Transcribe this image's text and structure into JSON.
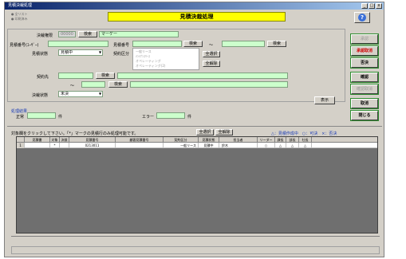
{
  "window": {
    "title": "見積決裁処理",
    "title_buttons": [
      "_",
      "□",
      "x"
    ]
  },
  "header": {
    "radios": [
      "全リスト",
      "印刷済み"
    ],
    "panel_title": "見積決裁処理",
    "help_glyph": "?"
  },
  "form": {
    "decision_authority_label": "決裁権限",
    "decision_authority_value": "00000",
    "decision_authority_button": "検索",
    "decision_authority_name": "マーケー",
    "customer_code_label": "見積番号(ﾕｰｻﾞｰ)",
    "estimate_no_label": "見積番号",
    "estimate_search_button": "検索",
    "range_sep": "～",
    "estimate_search_button2": "検索",
    "estimate_status_label": "見積状態",
    "estimate_status_value": "見積中",
    "contract_type_label": "契約区分",
    "contract_types": [
      "一般リース",
      "ﾒﾝﾃﾅﾝｽﾘｰｽ",
      "オペレーティング",
      "オペレーティング(2)"
    ],
    "select_all_button": "全選択",
    "clear_all_button": "全解除",
    "contractor_label": "契約先",
    "contractor_button": "検索",
    "contractor_range_sep": "～",
    "contractor_button2": "検索",
    "decider_label": "決裁状態",
    "decider_value": "未決",
    "display_button": "表示"
  },
  "counts": {
    "section_label": "処理結果",
    "ok_label": "正常",
    "ok_unit": "件",
    "error_label": "エラー",
    "error_unit": "件"
  },
  "side_buttons": [
    {
      "label": "承認",
      "style": "dis"
    },
    {
      "label": "承認取消",
      "style": "red"
    },
    {
      "label": "否決",
      "style": "normal"
    },
    {
      "label": "確認",
      "style": "normal"
    },
    {
      "label": "確認取消",
      "style": "dis"
    },
    {
      "label": "取消",
      "style": "normal"
    },
    {
      "label": "閉じる",
      "style": "normal"
    }
  ],
  "list_info": {
    "hint": "対象欄をクリックして下さい。「*」マークの見積行のみ処理可能です。",
    "select_all_button": "全選択",
    "clear_all_button": "全解除",
    "legend": "△：見積作成中　○：可決　×：否決"
  },
  "grid": {
    "columns": [
      "",
      "見積書",
      "対象",
      "決裁",
      "見積番号",
      "顧客見積番号",
      "契約区分",
      "見積状態",
      "担当者",
      "リーダー",
      "課長",
      "部長",
      "社長"
    ],
    "rows": [
      [
        "1",
        "",
        "*",
        "",
        "0213011",
        "",
        "一般リース",
        "見積中",
        "鈴木",
        "○",
        "△",
        "△",
        "△"
      ]
    ]
  }
}
